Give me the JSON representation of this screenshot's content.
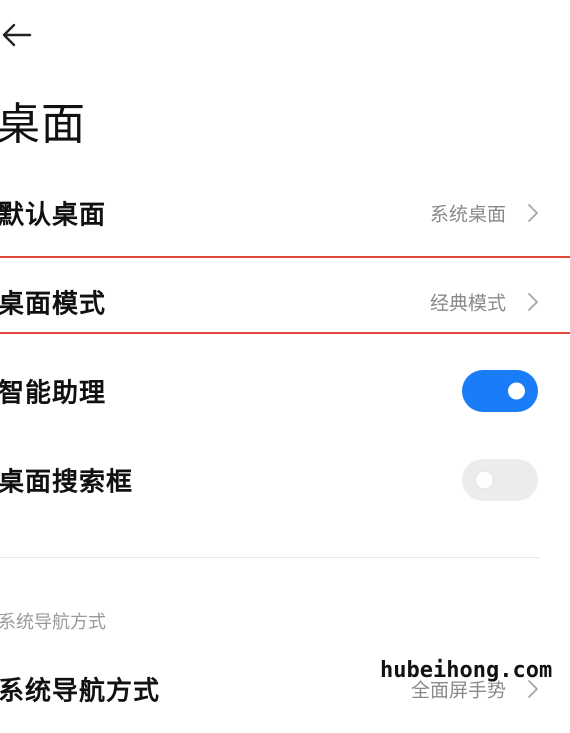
{
  "header": {
    "back_icon": "arrow-left-icon"
  },
  "page": {
    "title": "桌面"
  },
  "rows": [
    {
      "label": "默认桌面",
      "value": "系统桌面",
      "type": "nav"
    },
    {
      "label": "桌面模式",
      "value": "经典模式",
      "type": "nav",
      "highlighted": true
    },
    {
      "label": "智能助理",
      "type": "toggle",
      "state": "on"
    },
    {
      "label": "桌面搜索框",
      "type": "toggle",
      "state": "off"
    }
  ],
  "section": {
    "title": "系统导航方式"
  },
  "nav_row": {
    "label": "系统导航方式",
    "value": "全面屏手势"
  },
  "watermark": "hubeihong.com",
  "colors": {
    "accent": "#1a7cf6",
    "highlight_border": "#e0483c"
  }
}
